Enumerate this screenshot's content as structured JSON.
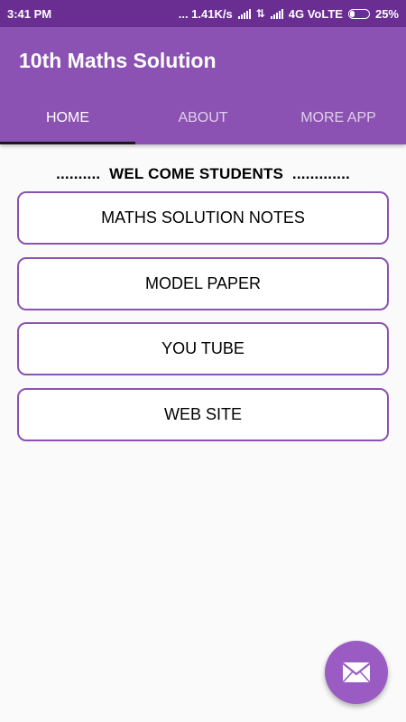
{
  "status_bar": {
    "time": "3:41 PM",
    "net_speed": "... 1.41K/s",
    "network_type": "4G VoLTE",
    "battery": "25%",
    "battery_level": 0.25
  },
  "app_bar": {
    "title": "10th Maths Solution",
    "tabs": [
      {
        "label": "HOME",
        "active": true
      },
      {
        "label": "ABOUT",
        "active": false
      },
      {
        "label": "MORE APP",
        "active": false
      }
    ]
  },
  "content": {
    "welcome_text": "..........  WEL COME STUDENTS  .............",
    "buttons": [
      {
        "label": "MATHS SOLUTION NOTES"
      },
      {
        "label": "MODEL PAPER"
      },
      {
        "label": "YOU TUBE"
      },
      {
        "label": "WEB SITE"
      }
    ]
  },
  "fab": {
    "icon": "mail-icon"
  },
  "colors": {
    "status_bar": "#6a2e93",
    "app_bar": "#8b52b3",
    "accent": "#9a5cc3",
    "tab_indicator": "#1a1a1a"
  }
}
